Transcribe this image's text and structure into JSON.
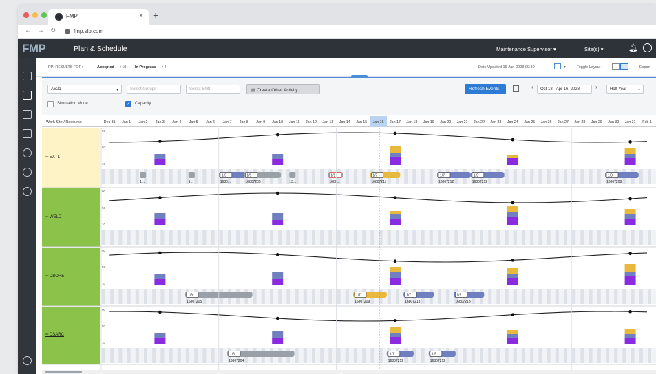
{
  "browser": {
    "tab_title": "FMP",
    "tab_close": "×",
    "new_tab": "+",
    "url": "fmp.slb.com",
    "traffic_colors": [
      "#ee5b56",
      "#f5bd4f",
      "#60c454"
    ]
  },
  "header": {
    "logo": "FMP",
    "title": "Plan & Schedule",
    "role": "Maintenance Supervisor",
    "sites": "Site(s)",
    "bg_color": "#2d3338"
  },
  "filters": {
    "prefix": "PPI RESULTS FOR:",
    "accepted": "Accepted",
    "accepted_count": "+10",
    "in_progress": "In Progress",
    "in_progress_count": "+4",
    "date_updated": "Date Updated 16-Jan-2023 09:30",
    "toggle_layout": "Toggle Layout",
    "export": "Export"
  },
  "toolbar": {
    "site_select": "AS21",
    "groups_placeholder": "Select Groups",
    "shift_placeholder": "Select Shift",
    "create_other_activity": "Create Other Activity",
    "refresh_events": "Refresh Events",
    "date_range": "Oct 18 - Apr 16, 2023",
    "period": "Half Year",
    "simulation_mode": "Simulation Mode",
    "capacity": "Capacity",
    "capacity_checked": true,
    "simulation_checked": false
  },
  "grid": {
    "resource_header": "Work Site / Resource",
    "dates": [
      "Dec 31",
      "Jan 1",
      "Jan 2",
      "Jan 3",
      "Jan 4",
      "Jan 5",
      "Jan 6",
      "Jan 7",
      "Jan 8",
      "Jan 9",
      "Jan 10",
      "Jan 11",
      "Jan 12",
      "Jan 13",
      "Jan 14",
      "Jan 15",
      "Jan 16",
      "Jan 17",
      "Jan 18",
      "Jan 19",
      "Jan 20",
      "Jan 21",
      "Jan 22",
      "Jan 23",
      "Jan 24",
      "Jan 25",
      "Jan 26",
      "Jan 27",
      "Jan 28",
      "Jan 29",
      "Jan 30",
      "Jan 31",
      "Feb 1"
    ],
    "today_label": "Jan 16",
    "axis_ticks": [
      "90",
      "50",
      "10"
    ],
    "colors": {
      "purple": "#8a2be2",
      "slate": "#6f7fc0",
      "gold": "#e8b93c",
      "grey_bar": "#9aa0a8",
      "today_line": "#e74c3c",
      "yellow_bg": "#fdf3c4",
      "green_bg": "#8bc34a"
    },
    "resources": [
      {
        "name": "EXTL",
        "bg": "yellow",
        "work_orders": [
          {
            "chip": "1/9",
            "id": "1680..."
          },
          {
            "chip": "1/9",
            "id": "16807205"
          },
          {
            "chip": "1/1",
            "id": "1680..."
          },
          {
            "chip": "1/7",
            "id": "16807211"
          },
          {
            "chip": "1/7",
            "id": "16807212"
          },
          {
            "chip": "1/9",
            "id": "16807212"
          },
          {
            "chip": "1/9",
            "id": "16807208"
          }
        ],
        "small_labels": [
          "1...",
          "1...",
          "13..."
        ]
      },
      {
        "name": "WELD",
        "bg": "green",
        "work_orders": [],
        "small_labels": []
      },
      {
        "name": "DBORE",
        "bg": "green",
        "work_orders": [
          {
            "chip": "1/9",
            "id": "16807205"
          },
          {
            "chip": "1/7",
            "id": "16807209"
          },
          {
            "chip": "1/7",
            "id": "16807213"
          },
          {
            "chip": "1/9",
            "id": "16807213"
          }
        ],
        "small_labels": []
      },
      {
        "name": "DSARC",
        "bg": "green",
        "work_orders": [
          {
            "chip": "1/6",
            "id": "16807204"
          },
          {
            "chip": "1/7",
            "id": "16807212"
          },
          {
            "chip": "1/9",
            "id": "16807212"
          }
        ],
        "small_labels": []
      }
    ]
  }
}
